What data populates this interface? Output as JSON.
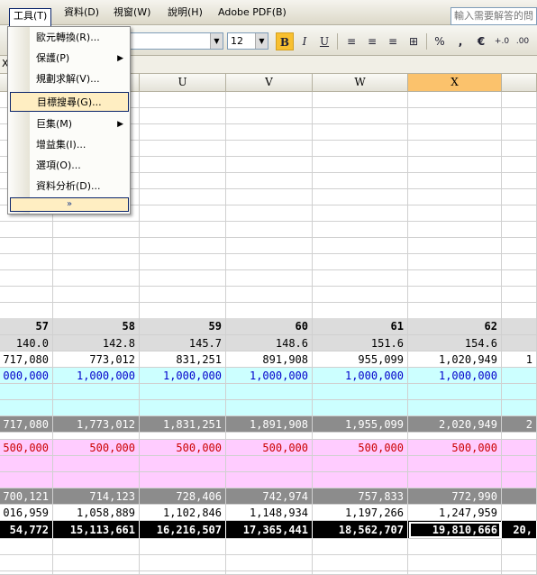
{
  "menubar": {
    "items": [
      {
        "label": "工具(T)"
      },
      {
        "label": "資料(D)"
      },
      {
        "label": "視窗(W)"
      },
      {
        "label": "說明(H)"
      },
      {
        "label": "Adobe PDF(B)"
      }
    ],
    "help_placeholder": "輸入需要解答的問"
  },
  "toolbar": {
    "font_size": "12",
    "bold": "B",
    "italic": "I",
    "underline": "U",
    "percent": "%",
    "comma": ",",
    "euro": "€",
    "inc_decimal": "+.0",
    "dec_decimal": ".00"
  },
  "formula": {
    "cell_ref": "X"
  },
  "columns": [
    "U",
    "V",
    "W",
    "X"
  ],
  "dropdown": {
    "items": [
      {
        "label": "歐元轉換(R)..."
      },
      {
        "label": "保護(P)"
      },
      {
        "label": "規劃求解(V)..."
      },
      {
        "label": "目標搜尋(G)..."
      },
      {
        "label": "巨集(M)"
      },
      {
        "label": "增益集(I)..."
      },
      {
        "label": "選項(O)..."
      },
      {
        "label": "資料分析(D)..."
      }
    ],
    "expand": "»"
  },
  "rows": [
    {
      "type": "header",
      "cells": [
        "57",
        "58",
        "59",
        "60",
        "61",
        "62",
        ""
      ]
    },
    {
      "type": "grey",
      "cells": [
        "140.0",
        "142.8",
        "145.7",
        "148.6",
        "151.6",
        "154.6",
        ""
      ]
    },
    {
      "type": "white",
      "cells": [
        "717,080",
        "773,012",
        "831,251",
        "891,908",
        "955,099",
        "1,020,949",
        "1"
      ]
    },
    {
      "type": "cyan",
      "cells": [
        "000,000",
        "1,000,000",
        "1,000,000",
        "1,000,000",
        "1,000,000",
        "1,000,000",
        ""
      ]
    },
    {
      "type": "darkgrey",
      "cells": [
        "717,080",
        "1,773,012",
        "1,831,251",
        "1,891,908",
        "1,955,099",
        "2,020,949",
        "2"
      ]
    },
    {
      "type": "pink",
      "cells": [
        "500,000",
        "500,000",
        "500,000",
        "500,000",
        "500,000",
        "500,000",
        ""
      ]
    },
    {
      "type": "darkgrey",
      "cells": [
        "700,121",
        "714,123",
        "728,406",
        "742,974",
        "757,833",
        "772,990",
        ""
      ]
    },
    {
      "type": "white",
      "cells": [
        "016,959",
        "1,058,889",
        "1,102,846",
        "1,148,934",
        "1,197,266",
        "1,247,959",
        ""
      ]
    },
    {
      "type": "black",
      "cells": [
        "54,772",
        "15,113,661",
        "16,216,507",
        "17,365,441",
        "18,562,707",
        "19,810,666",
        "20,"
      ]
    }
  ]
}
